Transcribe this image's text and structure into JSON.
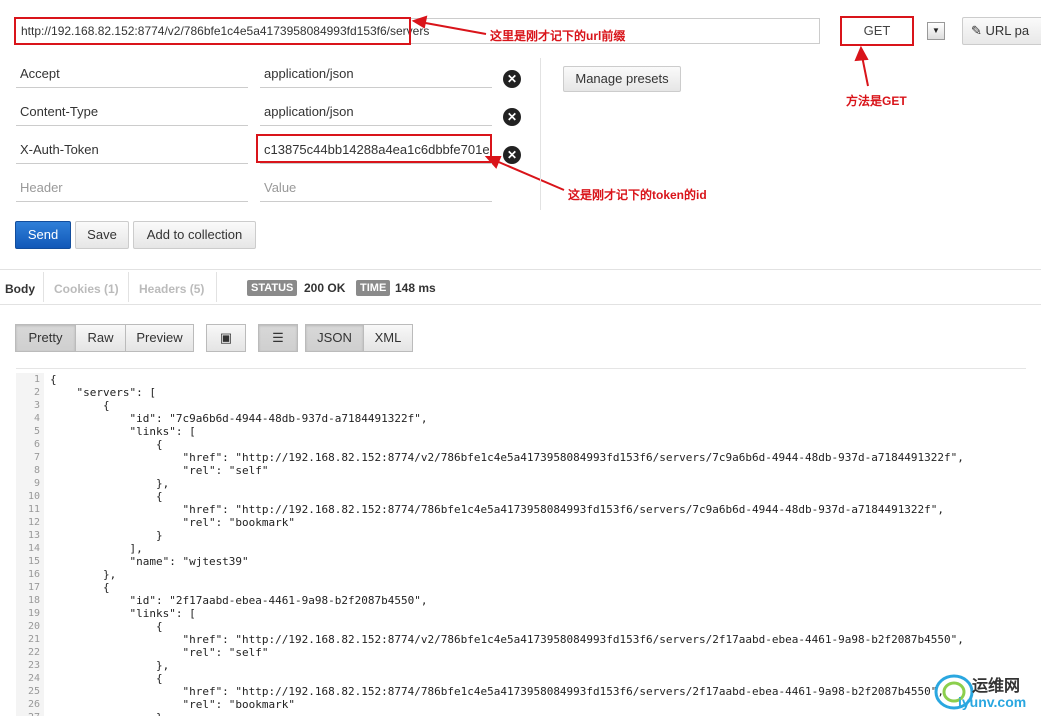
{
  "request": {
    "url": "http://192.168.82.152:8774/v2/786bfe1c4e5a4173958084993fd153f6/servers",
    "method": "GET",
    "url_params_label": "URL pa"
  },
  "annotations": {
    "url": "这里是刚才记下的url前缀",
    "method": "方法是GET",
    "token": "这是刚才记下的token的id"
  },
  "headers": [
    {
      "key": "Accept",
      "value": "application/json"
    },
    {
      "key": "Content-Type",
      "value": "application/json"
    },
    {
      "key": "X-Auth-Token",
      "value": "c13875c44bb14288a4ea1c6dbbfe701e"
    }
  ],
  "header_placeholder": {
    "key": "Header",
    "value": "Value"
  },
  "buttons": {
    "manage_presets": "Manage presets",
    "send": "Send",
    "save": "Save",
    "add_to_collection": "Add to collection"
  },
  "response_tabs": {
    "body": "Body",
    "cookies": "Cookies (1)",
    "headers": "Headers (5)"
  },
  "status": {
    "status_label": "STATUS",
    "status_value": "200 OK",
    "time_label": "TIME",
    "time_value": "148 ms"
  },
  "format": {
    "pretty": "Pretty",
    "raw": "Raw",
    "preview": "Preview",
    "json": "JSON",
    "xml": "XML"
  },
  "watermark": {
    "text": "运维网",
    "sub": "iyunv.com"
  },
  "code_lines": [
    "{",
    "    \"servers\": [",
    "        {",
    "            \"id\": \"7c9a6b6d-4944-48db-937d-a7184491322f\",",
    "            \"links\": [",
    "                {",
    "                    \"href\": \"http://192.168.82.152:8774/v2/786bfe1c4e5a4173958084993fd153f6/servers/7c9a6b6d-4944-48db-937d-a7184491322f\",",
    "                    \"rel\": \"self\"",
    "                },",
    "                {",
    "                    \"href\": \"http://192.168.82.152:8774/786bfe1c4e5a4173958084993fd153f6/servers/7c9a6b6d-4944-48db-937d-a7184491322f\",",
    "                    \"rel\": \"bookmark\"",
    "                }",
    "            ],",
    "            \"name\": \"wjtest39\"",
    "        },",
    "        {",
    "            \"id\": \"2f17aabd-ebea-4461-9a98-b2f2087b4550\",",
    "            \"links\": [",
    "                {",
    "                    \"href\": \"http://192.168.82.152:8774/v2/786bfe1c4e5a4173958084993fd153f6/servers/2f17aabd-ebea-4461-9a98-b2f2087b4550\",",
    "                    \"rel\": \"self\"",
    "                },",
    "                {",
    "                    \"href\": \"http://192.168.82.152:8774/786bfe1c4e5a4173958084993fd153f6/servers/2f17aabd-ebea-4461-9a98-b2f2087b4550\",",
    "                    \"rel\": \"bookmark\"",
    "                }"
  ],
  "colors": {
    "annotation": "#d9141a",
    "primary": "#1f6fd0"
  }
}
